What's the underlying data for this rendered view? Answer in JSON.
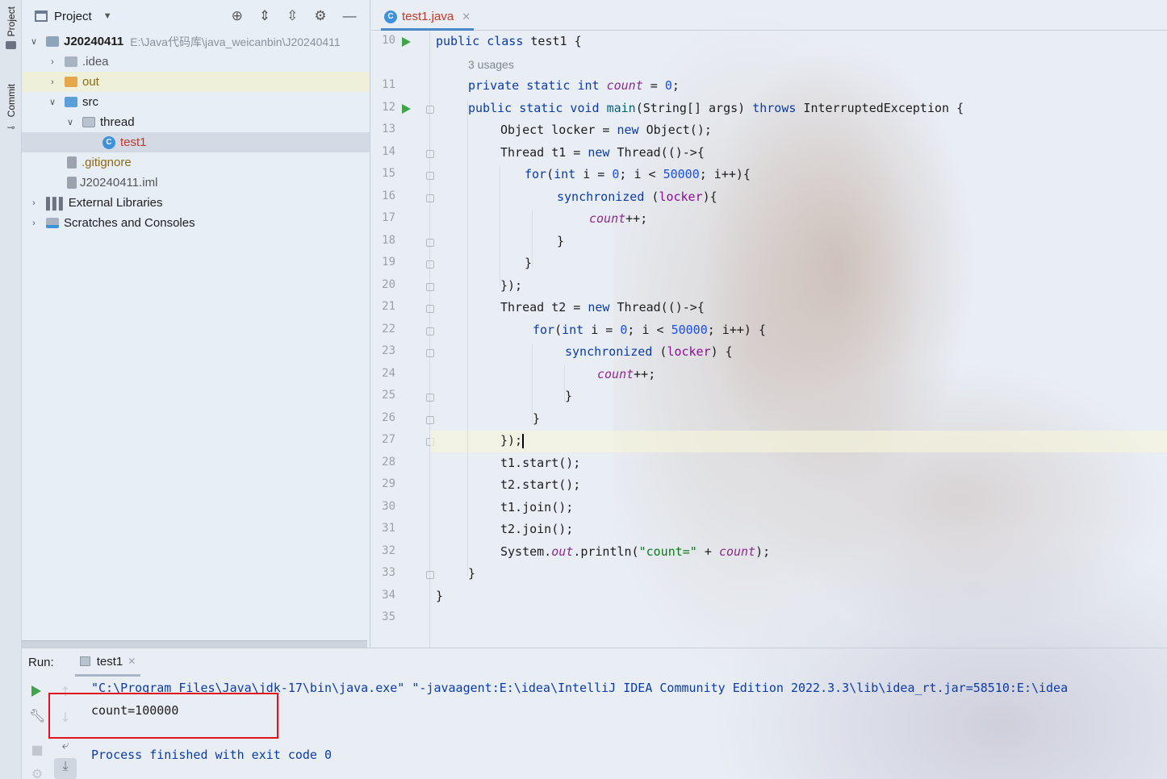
{
  "sidebar": {
    "project_label": "Project",
    "commit_label": "Commit"
  },
  "project_panel": {
    "title": "Project",
    "toolbar_icons": [
      "crosshair-icon",
      "expand-all-icon",
      "collapse-all-icon",
      "gear-icon",
      "minimize-icon"
    ],
    "tree": {
      "root": {
        "label": "J20240411",
        "path": "E:\\Java代码库\\java_weicanbin\\J20240411"
      },
      "idea": ".idea",
      "out": "out",
      "src": "src",
      "thread": "thread",
      "test1": "test1",
      "gitignore": ".gitignore",
      "iml": "J20240411.iml",
      "external": "External Libraries",
      "scratches": "Scratches and Consoles"
    }
  },
  "editor": {
    "tab_label": "test1.java",
    "hint_usages": "3 usages",
    "line_numbers": [
      "10",
      "11",
      "12",
      "13",
      "14",
      "15",
      "16",
      "17",
      "18",
      "19",
      "20",
      "21",
      "22",
      "23",
      "24",
      "25",
      "26",
      "27",
      "28",
      "29",
      "30",
      "31",
      "32",
      "33",
      "34",
      "35"
    ],
    "code": {
      "l10": {
        "a": "public class ",
        "b": "test1 {"
      },
      "l11": {
        "a": "private static int ",
        "f": "count",
        "b": " = ",
        "n": "0",
        "c": ";"
      },
      "l12": {
        "a": "public static void ",
        "m": "main",
        "b": "(String[] args) ",
        "t": "throws",
        "c": " InterruptedException {"
      },
      "l13": {
        "a": "Object locker = ",
        "k": "new",
        "b": " Object();"
      },
      "l14": {
        "a": "Thread t1 = ",
        "k": "new",
        "b": " Thread(()->{"
      },
      "l15": {
        "k": "for",
        "a": "(",
        "k2": "int",
        "b": " i = ",
        "n1": "0",
        "c": "; i < ",
        "n2": "50000",
        "d": "; i++){"
      },
      "l16": {
        "k": "synchronized",
        "a": " (",
        "p": "locker",
        "b": "){"
      },
      "l17": {
        "f": "count",
        "a": "++;"
      },
      "l18": "}",
      "l19": "}",
      "l20": "});",
      "l21": {
        "a": "Thread t2 = ",
        "k": "new",
        "b": " Thread(()->{"
      },
      "l22": {
        "k": "for",
        "a": "(",
        "k2": "int",
        "b": " i = ",
        "n1": "0",
        "c": "; i < ",
        "n2": "50000",
        "d": "; i++) {"
      },
      "l23": {
        "k": "synchronized",
        "a": " (",
        "p": "locker",
        "b": ") {"
      },
      "l24": {
        "f": "count",
        "a": "++;"
      },
      "l25": "}",
      "l26": "}",
      "l27": "});",
      "l28": "t1.start();",
      "l29": "t2.start();",
      "l30": "t1.join();",
      "l31": "t2.join();",
      "l32": {
        "a": "System.",
        "o": "out",
        "b": ".println(",
        "s": "\"count=\"",
        "c": " + ",
        "f": "count",
        "d": ");"
      },
      "l33": "}",
      "l34": "}"
    }
  },
  "run_panel": {
    "run_label": "Run:",
    "tab_label": "test1",
    "command": "\"C:\\Program Files\\Java\\jdk-17\\bin\\java.exe\" \"-javaagent:E:\\idea\\IntelliJ IDEA Community Edition 2022.3.3\\lib\\idea_rt.jar=58510:E:\\idea",
    "output": "count=100000",
    "exit": "Process finished with exit code 0"
  },
  "colors": {
    "keyword": "#0b3ba6",
    "field": "#8b2a8b",
    "number": "#1750eb",
    "string": "#067d17",
    "highlight_box": "#e0141e",
    "run_green": "#3fa44a"
  }
}
